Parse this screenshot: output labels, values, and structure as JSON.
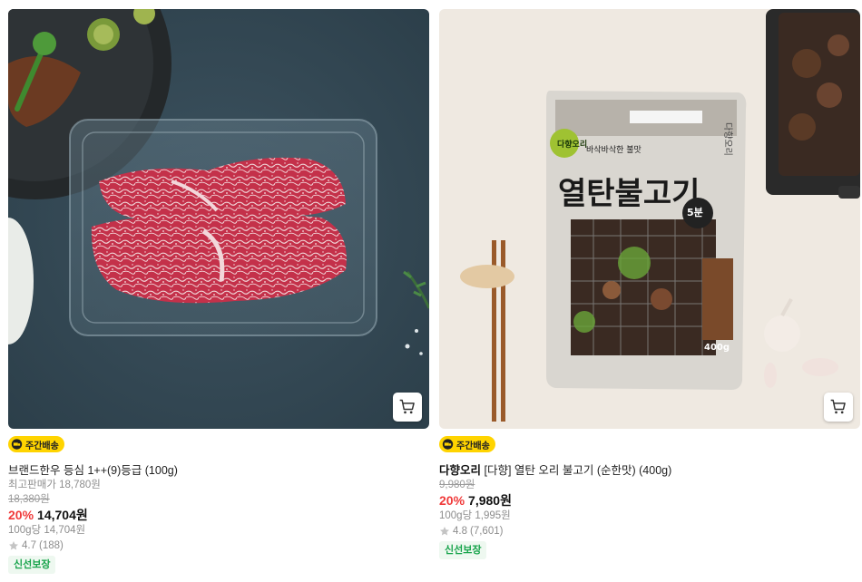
{
  "products": [
    {
      "delivery_badge": "주간배송",
      "brand": "",
      "title": "브랜드한우 등심 1++(9)등급 (100g)",
      "max_price_label": "최고판매가 18,780원",
      "original_price": "18,380원",
      "discount_rate": "20%",
      "price": "14,704원",
      "unit_price": "100g당 14,704원",
      "rating": "4.7",
      "review_count": "(188)",
      "fresh_badge": "신선보장"
    },
    {
      "delivery_badge": "주간배송",
      "brand": "다향오리",
      "title": "[다향] 열탄 오리 불고기 (순한맛) (400g)",
      "original_price": "9,980원",
      "discount_rate": "20%",
      "price": "7,980원",
      "unit_price": "100g당 1,995원",
      "rating": "4.8",
      "review_count": "(7,601)",
      "fresh_badge": "신선보장",
      "package_text": {
        "logo": "다향오리",
        "tagline": "바삭바삭한 불맛",
        "name": "열탄불고기",
        "cook_time": "5분",
        "weight": "400g",
        "side_label": "다향오리"
      }
    }
  ],
  "colors": {
    "discount": "#f03a3a",
    "delivery_badge_bg": "#ffd400",
    "fresh_badge": "#16a34a"
  },
  "icons": {
    "cart": "cart-icon",
    "star": "star-icon",
    "truck": "truck-icon"
  }
}
